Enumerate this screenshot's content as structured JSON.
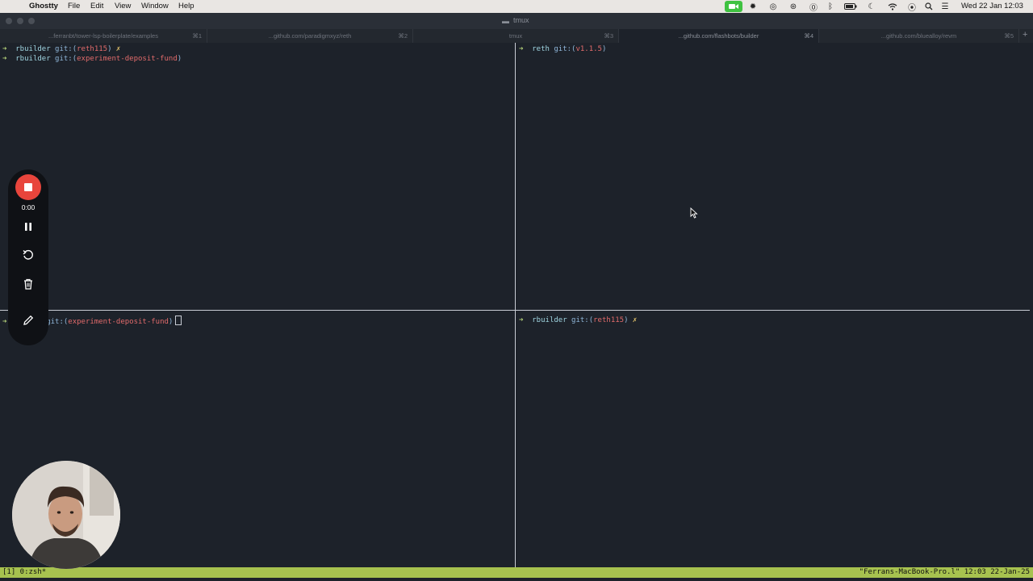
{
  "menubar": {
    "app": "Ghostty",
    "items": [
      "File",
      "Edit",
      "View",
      "Window",
      "Help"
    ],
    "datetime": "Wed 22 Jan  12:03"
  },
  "window": {
    "title": "tmux"
  },
  "tabs": [
    {
      "label": "...ferranbt/tower-lsp-boilerplate/examples",
      "shortcut": "⌘1"
    },
    {
      "label": "...github.com/paradigmxyz/reth",
      "shortcut": "⌘2"
    },
    {
      "label": "tmux",
      "shortcut": "⌘3"
    },
    {
      "label": "...github.com/flashbots/builder",
      "shortcut": "⌘4"
    },
    {
      "label": "...github.com/bluealloy/revm",
      "shortcut": "⌘5"
    }
  ],
  "new_tab_label": "+",
  "panes": {
    "top_left": {
      "lines": [
        {
          "arrow": "➜",
          "dir": "rbuilder",
          "git": "git:(",
          "branch": "reth115",
          "close": ")",
          "dirty": "✗"
        },
        {
          "arrow": "➜",
          "dir": "rbuilder",
          "git": "git:(",
          "branch": "experiment-deposit-fund",
          "close": ")",
          "dirty": ""
        }
      ]
    },
    "top_right": {
      "lines": [
        {
          "arrow": "➜",
          "dir": "reth",
          "git": "git:(",
          "branch": "v1.1.5",
          "close": ")",
          "dirty": ""
        }
      ]
    },
    "bottom_left": {
      "lines": [
        {
          "arrow": "➜",
          "git": "git:(",
          "branch": "experiment-deposit-fund",
          "close": ")"
        }
      ]
    },
    "bottom_right": {
      "lines": [
        {
          "arrow": "➜",
          "dir": "rbuilder",
          "git": "git:(",
          "branch": "reth115",
          "close": ")",
          "dirty": "✗"
        }
      ]
    }
  },
  "statusbar": {
    "left": "[1] 0:zsh*",
    "right": "\"Ferrans-MacBook-Pro.l\" 12:03 22-Jan-25"
  },
  "recorder": {
    "timer": "0:00"
  },
  "colors": {
    "background": "#1d222a",
    "status_bar": "#a7c24f",
    "branch": "#e26b6b",
    "prompt_arrow": "#b5d37a",
    "record_red": "#e8453c"
  }
}
